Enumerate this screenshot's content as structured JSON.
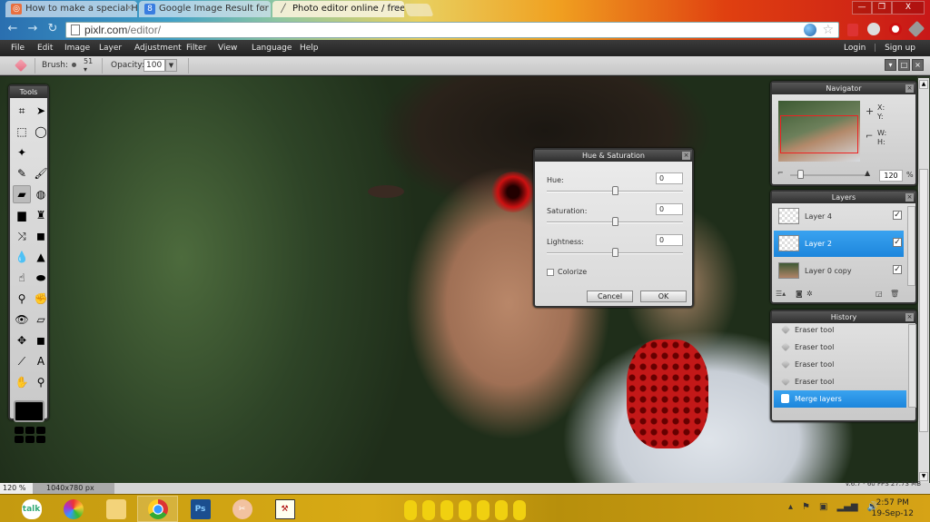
{
  "browser": {
    "tabs": [
      {
        "label": "How to make a special Hal",
        "icon": "blog-icon",
        "active": false
      },
      {
        "label": "Google Image Result for ht",
        "icon": "google-icon",
        "active": false
      },
      {
        "label": "Photo editor online / free i",
        "icon": "pixlr-icon",
        "active": true
      }
    ],
    "url_host": "pixlr.com",
    "url_path": "/editor/",
    "window_buttons": {
      "minimize": "—",
      "restore": "❐",
      "close": "X"
    }
  },
  "menubar": {
    "items": [
      "File",
      "Edit",
      "Image",
      "Layer",
      "Adjustment",
      "Filter",
      "View",
      "Language",
      "Help"
    ],
    "login": "Login",
    "separator": "|",
    "signup": "Sign up"
  },
  "options": {
    "brush_label": "Brush:",
    "brush_size": "51",
    "opacity_label": "Opacity:",
    "opacity_value": "100"
  },
  "tools": {
    "title": "Tools",
    "items": [
      {
        "name": "crop-tool",
        "glyph": "⌗"
      },
      {
        "name": "move-tool",
        "glyph": "➤"
      },
      {
        "name": "marquee-tool",
        "glyph": "⬚"
      },
      {
        "name": "lasso-tool",
        "glyph": "◯"
      },
      {
        "name": "magic-wand-tool",
        "glyph": "✦"
      },
      {
        "name": "empty-slot",
        "glyph": ""
      },
      {
        "name": "pencil-tool",
        "glyph": "✎"
      },
      {
        "name": "brush-tool",
        "glyph": "🖌"
      },
      {
        "name": "eraser-tool",
        "glyph": "▰"
      },
      {
        "name": "paint-bucket-tool",
        "glyph": "◍"
      },
      {
        "name": "gradient-tool",
        "glyph": "▆"
      },
      {
        "name": "clone-stamp-tool",
        "glyph": "♜"
      },
      {
        "name": "color-replace-tool",
        "glyph": "⤨"
      },
      {
        "name": "drawing-tool",
        "glyph": "◼"
      },
      {
        "name": "blur-tool",
        "glyph": "💧"
      },
      {
        "name": "sharpen-tool",
        "glyph": "▲"
      },
      {
        "name": "smudge-tool",
        "glyph": "☝"
      },
      {
        "name": "sponge-tool",
        "glyph": "⬬"
      },
      {
        "name": "dodge-tool",
        "glyph": "⚲"
      },
      {
        "name": "burn-tool",
        "glyph": "✊"
      },
      {
        "name": "red-eye-tool",
        "glyph": "👁"
      },
      {
        "name": "spot-heal-tool",
        "glyph": "▱"
      },
      {
        "name": "bloat-tool",
        "glyph": "✥"
      },
      {
        "name": "pinch-tool",
        "glyph": "◼"
      },
      {
        "name": "color-picker-tool",
        "glyph": "⟋"
      },
      {
        "name": "type-tool",
        "glyph": "A"
      },
      {
        "name": "hand-tool",
        "glyph": "✋"
      },
      {
        "name": "zoom-tool",
        "glyph": "⚲"
      }
    ]
  },
  "dialog": {
    "title": "Hue & Saturation",
    "hue_label": "Hue:",
    "hue_value": "0",
    "saturation_label": "Saturation:",
    "saturation_value": "0",
    "lightness_label": "Lightness:",
    "lightness_value": "0",
    "slider_position": 0.5,
    "colorize_label": "Colorize",
    "colorize_checked": false,
    "cancel_label": "Cancel",
    "ok_label": "OK"
  },
  "navigator": {
    "title": "Navigator",
    "x_label": "X:",
    "y_label": "Y:",
    "w_label": "W:",
    "h_label": "H:",
    "zoom_value": "120",
    "zoom_unit": "%",
    "zoom_slider_position": 0.14
  },
  "layers": {
    "title": "Layers",
    "items": [
      {
        "name": "Layer 4",
        "visible": true,
        "selected": false,
        "thumb": "transparent"
      },
      {
        "name": "Layer 2",
        "visible": true,
        "selected": true,
        "thumb": "transparent"
      },
      {
        "name": "Layer 0 copy",
        "visible": true,
        "selected": false,
        "thumb": "photo"
      }
    ],
    "check_glyph": "✓"
  },
  "history": {
    "title": "History",
    "items": [
      {
        "name": "Eraser tool",
        "selected": false
      },
      {
        "name": "Eraser tool",
        "selected": false
      },
      {
        "name": "Eraser tool",
        "selected": false
      },
      {
        "name": "Eraser tool",
        "selected": false
      },
      {
        "name": "Merge layers",
        "selected": true
      }
    ]
  },
  "status": {
    "zoom": "120 %",
    "dimensions": "1040x780 px",
    "version": "v.6.7 - 60 FPS 27.73 MB"
  },
  "taskbar": {
    "apps": [
      {
        "name": "google-talk",
        "label": "talk"
      },
      {
        "name": "picasa",
        "label": ""
      },
      {
        "name": "file-explorer",
        "label": ""
      },
      {
        "name": "chrome",
        "label": ""
      },
      {
        "name": "photoshop",
        "label": "Ps"
      },
      {
        "name": "snipping-tool",
        "label": ""
      },
      {
        "name": "app-hammer",
        "label": ""
      }
    ],
    "time": "2:57 PM",
    "date": "19-Sep-12"
  },
  "colors": {
    "selection_blue": "#1c86dc",
    "menubar_bg": "#2a2a2a",
    "taskbar_gold": "#d2a414"
  }
}
